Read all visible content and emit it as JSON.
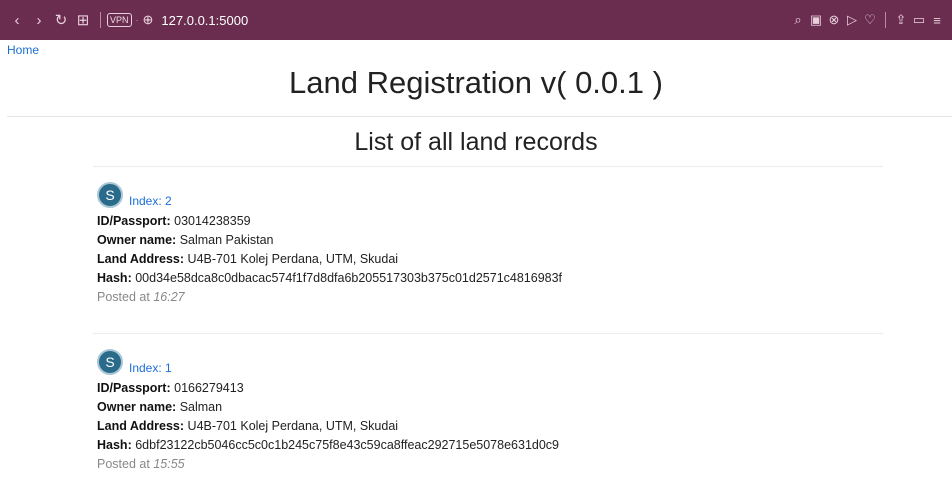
{
  "browser": {
    "vpn_label": "VPN",
    "url": "127.0.0.1:5000"
  },
  "nav": {
    "home": "Home"
  },
  "page": {
    "title": "Land Registration v( 0.0.1 )",
    "subtitle": "List of all land records"
  },
  "labels": {
    "id": "ID/Passport",
    "owner": "Owner name",
    "address": "Land Address",
    "hash": "Hash",
    "posted_prefix": "Posted at"
  },
  "records": [
    {
      "avatar": "S",
      "index": "Index: 2",
      "id": "03014238359",
      "owner": "Salman Pakistan",
      "address": "U4B-701 Kolej Perdana, UTM, Skudai",
      "hash": "00d34e58dca8c0dbacac574f1f7d8dfa6b205517303b375c01d2571c4816983f",
      "time": "16:27"
    },
    {
      "avatar": "S",
      "index": "Index: 1",
      "id": "0166279413",
      "owner": "Salman",
      "address": "U4B-701 Kolej Perdana, UTM, Skudai",
      "hash": "6dbf23122cb5046cc5c0c1b245c75f8e43c59ca8ffeac292715e5078e631d0c9",
      "time": "15:55"
    }
  ],
  "colors": {
    "chrome_bg": "#6a2d4f",
    "link": "#1a6fd6",
    "avatar_bg": "#2a6a8a"
  }
}
